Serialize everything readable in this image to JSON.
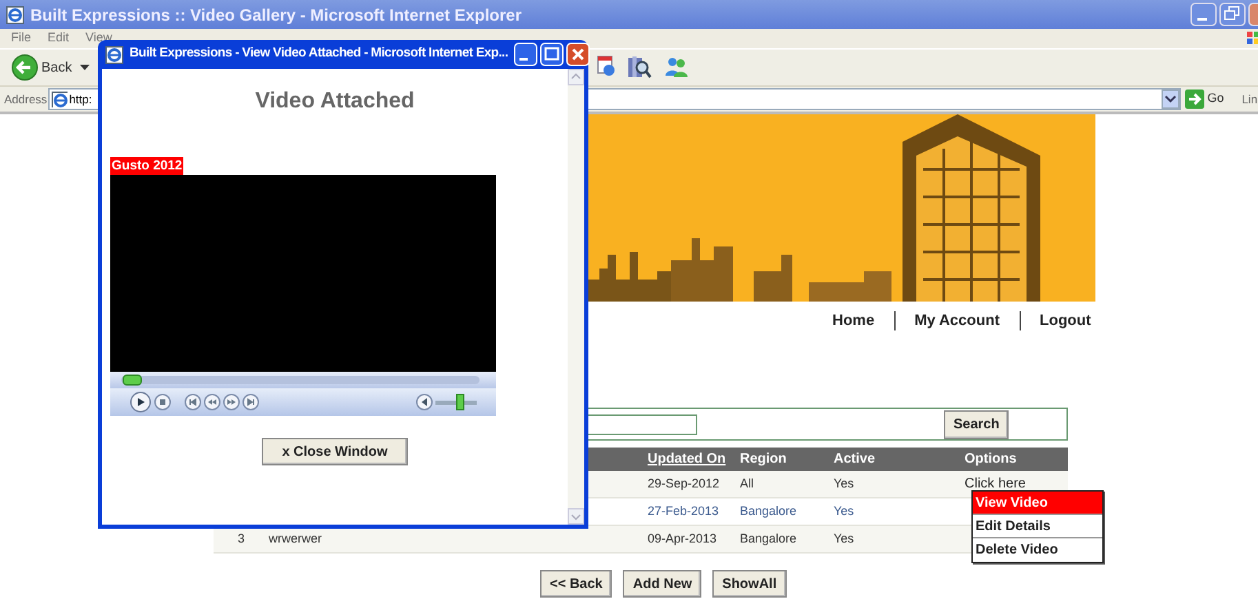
{
  "browser": {
    "title": "Built Expressions :: Video Gallery - Microsoft Internet Explorer",
    "menu": [
      "File",
      "Edit",
      "View"
    ],
    "back_label": "Back",
    "address": {
      "label": "Address",
      "value": "http:"
    },
    "go_label": "Go",
    "links_label": "Lin"
  },
  "page": {
    "nav": [
      "Home",
      "My Account",
      "Logout"
    ],
    "search_button": "Search",
    "columns": [
      {
        "label": "Updated On",
        "link": true
      },
      {
        "label": "Region",
        "link": false
      },
      {
        "label": "Active",
        "link": false
      },
      {
        "label": "Options",
        "link": false
      }
    ],
    "rows": [
      {
        "updated_on": "29-Sep-2012",
        "region": "All",
        "active": "Yes",
        "options": "Click here",
        "hovered": false
      },
      {
        "updated_on": "27-Feb-2013",
        "region": "Bangalore",
        "active": "Yes",
        "hovered": true
      },
      {
        "number": "3",
        "name": "wrwerwer",
        "updated_on": "09-Apr-2013",
        "region": "Bangalore",
        "active": "Yes",
        "hovered": false
      }
    ],
    "options_menu": [
      {
        "label": "View Video",
        "selected": true
      },
      {
        "label": "Edit Details",
        "selected": false
      },
      {
        "label": "Delete Video",
        "selected": false
      }
    ],
    "buttons": [
      "<< Back",
      "Add New",
      "ShowAll"
    ]
  },
  "popup": {
    "title": "Built Expressions - View Video Attached - Microsoft Internet Exp...",
    "heading": "Video Attached",
    "caption": "Gusto 2012",
    "seek": {
      "level": 0.03
    },
    "volume": {
      "level": 0.6
    },
    "close_button": "x Close Window"
  }
}
